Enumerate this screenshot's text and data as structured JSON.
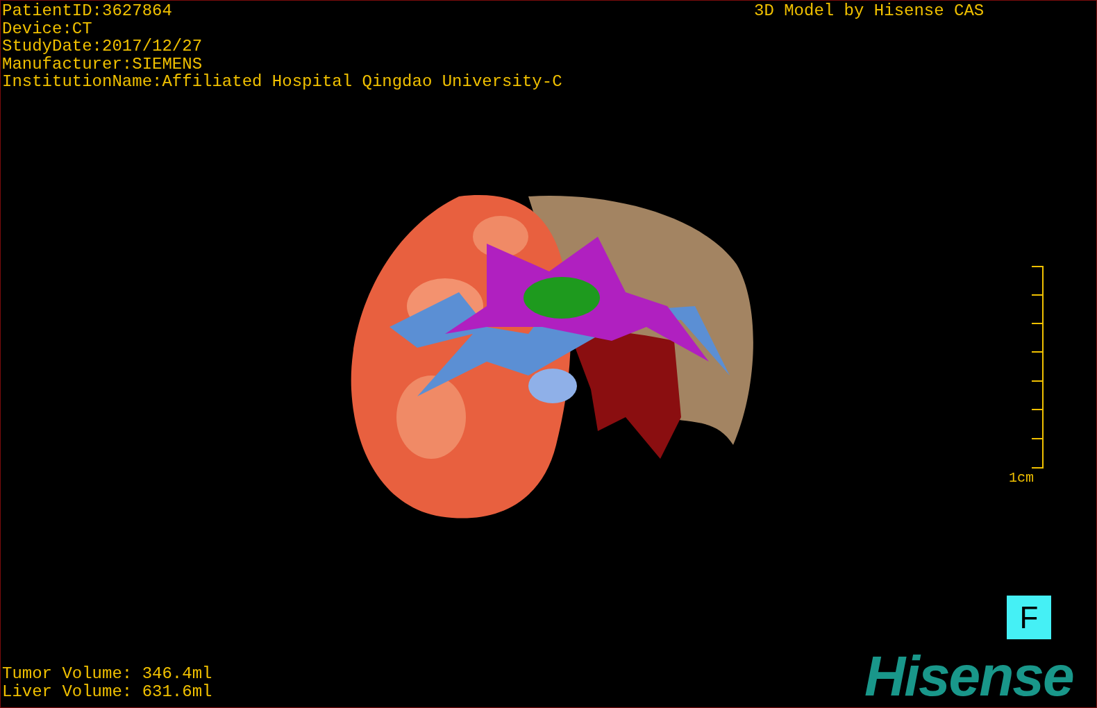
{
  "study_info": [
    "PatientID:3627864",
    "Device:CT",
    "StudyDate:2017/12/27",
    "Manufacturer:SIEMENS",
    "InstitutionName:Affiliated Hospital Qingdao University-C"
  ],
  "model_credit": "3D Model by Hisense CAS",
  "scale_bar": {
    "label": "1cm"
  },
  "orientation_marker": "F",
  "volumes": [
    "Tumor Volume: 346.4ml",
    "Liver Volume: 631.6ml"
  ],
  "logo": "Hisense"
}
